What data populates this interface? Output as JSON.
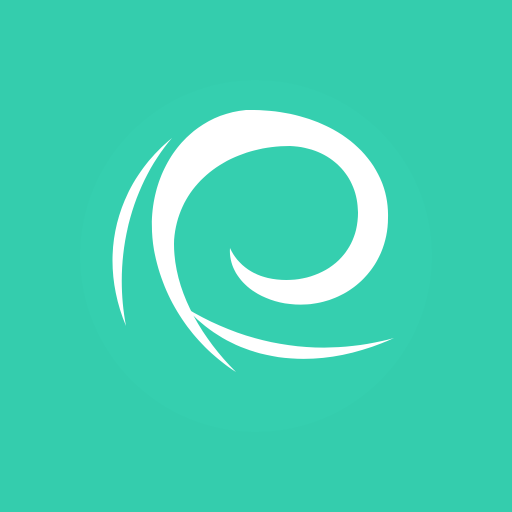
{
  "icon": {
    "name": "swirl-e-logo-icon",
    "background_color": "#34CDAD",
    "halo_color": "#37D1B1",
    "mark_color": "#FFFFFF"
  }
}
